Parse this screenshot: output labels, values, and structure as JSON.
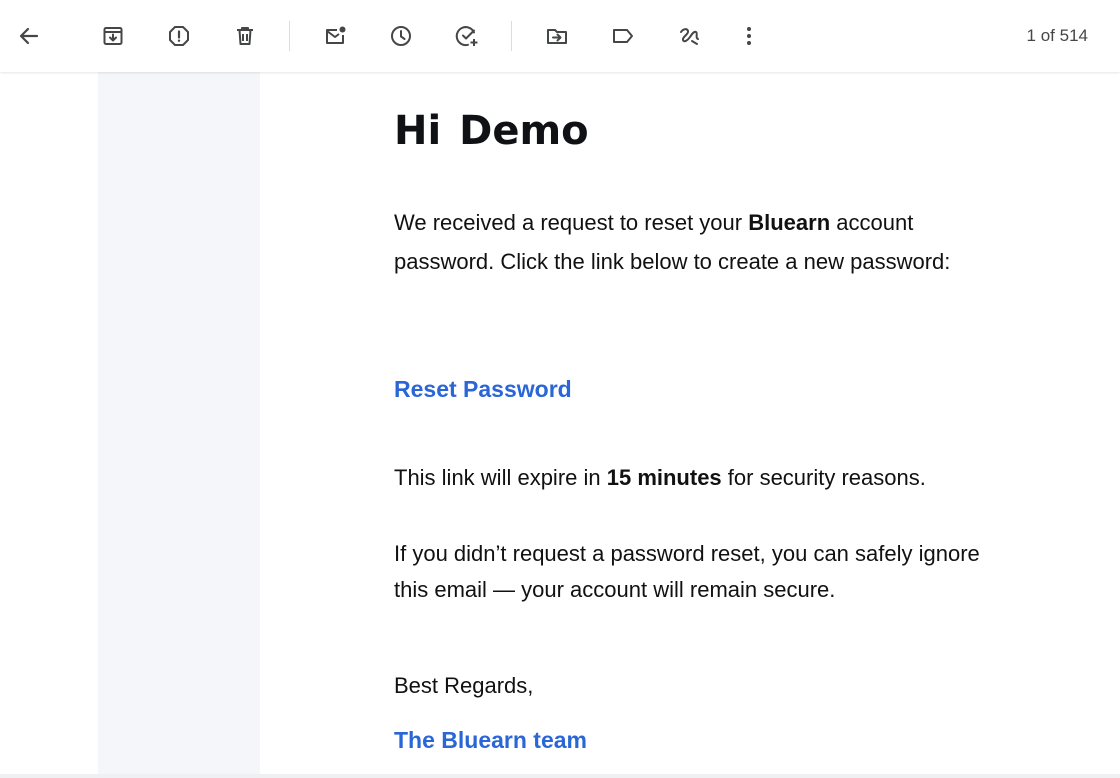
{
  "toolbar": {
    "icons": [
      "back-arrow-icon",
      "archive-icon",
      "report-spam-icon",
      "delete-icon",
      "mark-unread-icon",
      "snooze-icon",
      "add-task-icon",
      "move-to-icon",
      "label-icon",
      "apps-integration-icon",
      "more-options-icon"
    ],
    "pager_text": "1 of 514"
  },
  "email": {
    "greeting": "Hi Demo",
    "p1_before": "We received a request to reset your ",
    "p1_bold": "Bluearn",
    "p1_after": " account password. Click the link below to create a new password:",
    "reset_link": "Reset Password",
    "p2_before": "This link will expire in ",
    "p2_bold": "15 minutes",
    "p2_after": " for security reasons.",
    "p3": "If you didn’t request a password reset, you can safely ignore this email — your account will remain secure.",
    "signoff": "Best Regards,",
    "team": "The Bluearn team"
  },
  "colors": {
    "link": "#2a66d6",
    "gutter": "#f5f6fa",
    "icon": "#444746"
  }
}
